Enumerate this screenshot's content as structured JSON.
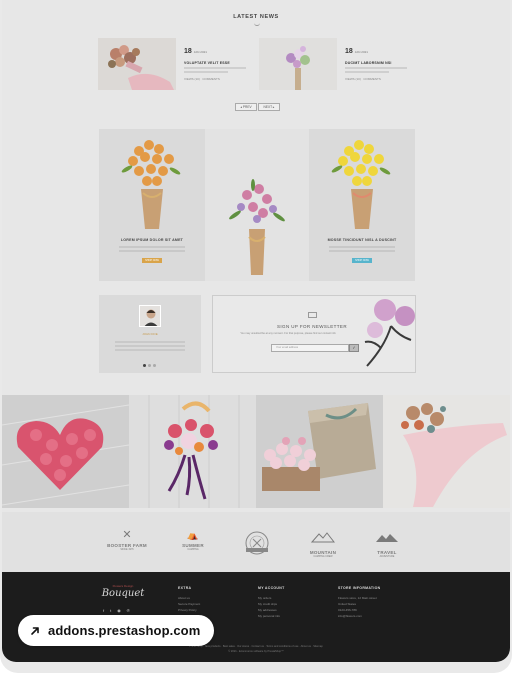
{
  "latest_news": {
    "title": "LATEST NEWS",
    "posts": [
      {
        "day": "18",
        "month": "JAN 2021",
        "headline": "VOLUPTATE VELIT ESSE",
        "views": "VIEWS (10)",
        "comments": "COMMENTS"
      },
      {
        "day": "18",
        "month": "JAN 2021",
        "headline": "DUCIMT LABORSNIM NSI",
        "views": "VIEWS (10)",
        "comments": "COMMENTS"
      }
    ],
    "pager": {
      "prev": "◂ PREV",
      "next": "NEXT ▸"
    }
  },
  "bouquets": [
    {
      "caption": "LOREM IPSUM DOLOR SIT AMET",
      "button": "SHOP NOW",
      "button_color": "#d9a44a"
    },
    {
      "caption": "",
      "button": "",
      "button_color": ""
    },
    {
      "caption": "MOSSE TINCIDUNT NISL A DUSCINT",
      "button": "SHOP NOW",
      "button_color": "#57b4cc"
    }
  ],
  "testimonial": {
    "name": "JOHN DOE"
  },
  "newsletter": {
    "title": "SIGN UP FOR NEWSLETTER",
    "subtitle": "You may unsubscribe at any moment. For that purpose, please find our contact info",
    "placeholder": "Your email address",
    "submit": "✓"
  },
  "brands": [
    {
      "name": "BOOSTER FARM",
      "sub": "SINCE 1976"
    },
    {
      "name": "SUMMER",
      "sub": "CAMPING"
    },
    {
      "name": "",
      "sub": ""
    },
    {
      "name": "MOUNTAIN",
      "sub": "CAMPING CREW"
    },
    {
      "name": "TRAVEL",
      "sub": "ADVENTURE"
    }
  ],
  "footer": {
    "logo_top": "Flowers Design",
    "logo_main": "Bouquet",
    "social": [
      "f",
      "t",
      "◉",
      "℗"
    ],
    "extra": {
      "title": "EXTRA",
      "items": [
        "About us",
        "Secure Payment",
        "Privacy Policy"
      ]
    },
    "account": {
      "title": "MY ACCOUNT",
      "items": [
        "My orders",
        "My credit slips",
        "My addresses",
        "My personal info"
      ]
    },
    "store": {
      "title": "STORE INFORMATION",
      "items": [
        "Flowers store, 12 Main street",
        "United States",
        "0123-456-789",
        "info@flowers.com"
      ]
    },
    "links": "Prices drop · New products · Best sales · Our stores · Contact us · Terms and conditions of use · About us · Sitemap",
    "copyright": "© 2021 - Ecommerce software by PrestaShop™"
  },
  "source_pill": {
    "text": "addons.prestashop.com"
  }
}
